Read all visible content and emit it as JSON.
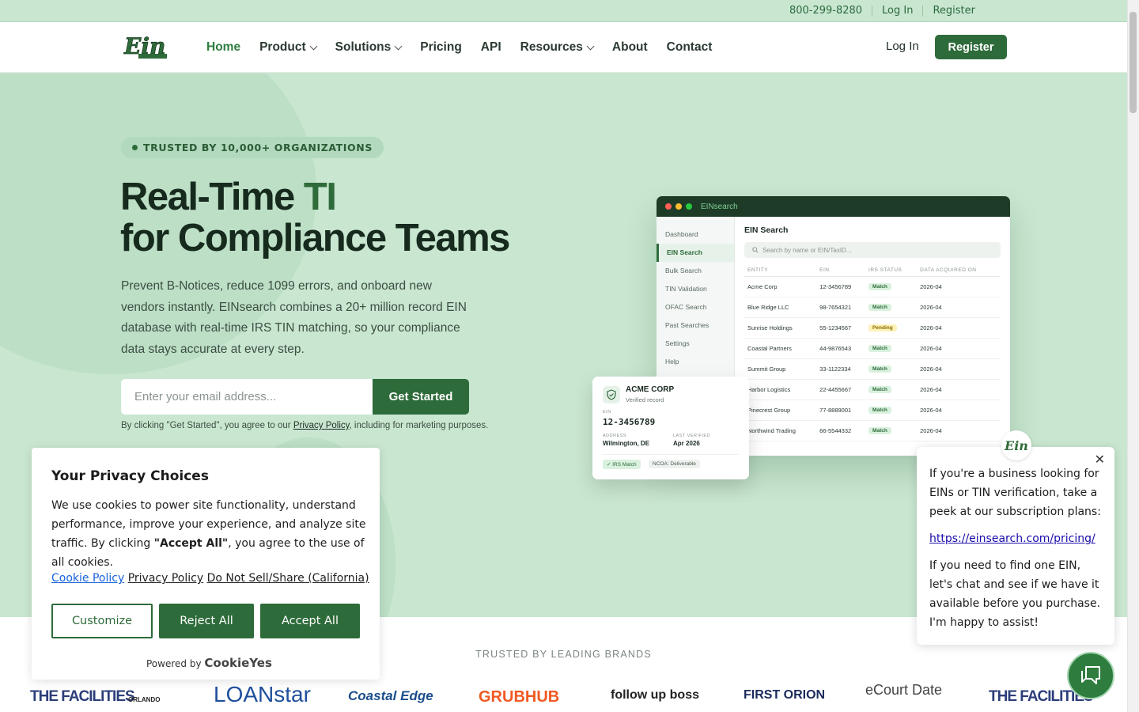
{
  "topbar": {
    "phone": "800-299-8280",
    "login": "Log In",
    "register": "Register"
  },
  "nav": {
    "items": [
      {
        "label": "Home"
      },
      {
        "label": "Product"
      },
      {
        "label": "Solutions"
      },
      {
        "label": "Pricing"
      },
      {
        "label": "API"
      },
      {
        "label": "Resources"
      },
      {
        "label": "About"
      },
      {
        "label": "Contact"
      }
    ],
    "login": "Log In",
    "register": "Register",
    "logo": "EIN"
  },
  "hero": {
    "badge": "TRUSTED BY 10,000+ ORGANIZATIONS",
    "title_line1_a": "Real-Time ",
    "title_line1_b": "TI",
    "title_line2": "for Compliance Teams",
    "subtitle": "Prevent B-Notices, reduce 1099 errors, and onboard new vendors instantly. EINsearch combines a 20+ million record EIN database with real-time IRS TIN matching, so your compliance data stays accurate at every step.",
    "email_placeholder": "Enter your email address...",
    "cta": "Get Started",
    "terms_pre": "By clicking \"Get Started\", you agree to our ",
    "terms_link": "Privacy Policy",
    "terms_post": ", including for marketing purposes."
  },
  "app_preview": {
    "window_title": "EINsearch",
    "sidebar": [
      "Dashboard",
      "EIN Search",
      "Bulk Search",
      "TIN Validation",
      "OFAC Search",
      "Past Searches",
      "Settings",
      "Help"
    ],
    "heading": "EIN Search",
    "search_placeholder": "Search by name or EIN/TaxID...",
    "columns": [
      "ENTITY",
      "EIN",
      "IRS STATUS",
      "DATA ACQUIRED ON"
    ],
    "rows": [
      {
        "entity": "Acme Corp",
        "ein": "12-3456789",
        "status": "Match",
        "date": "2026-04"
      },
      {
        "entity": "Blue Ridge LLC",
        "ein": "98-7654321",
        "status": "Match",
        "date": "2026-04"
      },
      {
        "entity": "Sunrise Holdings",
        "ein": "55-1234567",
        "status": "Pending",
        "date": "2026-04"
      },
      {
        "entity": "Coastal Partners",
        "ein": "44-9876543",
        "status": "Match",
        "date": "2026-04"
      },
      {
        "entity": "Summit Group",
        "ein": "33-1122334",
        "status": "Match",
        "date": "2026-04"
      },
      {
        "entity": "Harbor Logistics",
        "ein": "22-4455667",
        "status": "Match",
        "date": "2026-04"
      },
      {
        "entity": "Pinecrest Group",
        "ein": "77-8889001",
        "status": "Match",
        "date": "2026-04"
      },
      {
        "entity": "Northwind Trading",
        "ein": "66-5544332",
        "status": "Match",
        "date": "2026-04"
      }
    ]
  },
  "record_card": {
    "name": "ACME CORP",
    "verified": "Verified record",
    "ein_label": "EIN",
    "ein": "12-3456789",
    "address_label": "ADDRESS",
    "address": "Wilmington, DE",
    "last_label": "LAST VERIFIED",
    "last": "Apr 2026",
    "tag1": "✓ IRS Match",
    "tag2": "NCOA: Deliverable"
  },
  "cookie": {
    "title": "Your Privacy Choices",
    "body_pre": "We use cookies to power site functionality, understand performance, improve your experience, and analyze site traffic. By clicking ",
    "body_bold": "\"Accept All\"",
    "body_post": ", you agree to the use of all cookies.",
    "link1": "Cookie Policy",
    "link2": "Privacy Policy",
    "link3": "Do Not Sell/Share (California)",
    "customize": "Customize",
    "reject": "Reject All",
    "accept": "Accept All",
    "powered": "Powered by",
    "brand": "CookieYes"
  },
  "chat": {
    "close": "✕",
    "p1": "If you're a business looking for EINs or TIN verification, take a peek at our subscription plans:",
    "link": "https://einsearch.com/pricing/",
    "p2": "If you need to find one EIN, let's chat and see if we have it available before you purchase. I'm happy to assist!"
  },
  "trusted": {
    "title": "TRUSTED BY LEADING BRANDS",
    "brands": [
      "THE FACILITIES",
      "ORLANDO",
      "LOANstar",
      "Coastal Edge",
      "GRUBHUB",
      "follow up boss",
      "FIRST ORION",
      "eCourt Date",
      "THE FACILITIES"
    ]
  },
  "colors": {
    "brand_green": "#2e6b3a",
    "hero_bg": "#c8e6d0",
    "pending": "#fdf1b8"
  }
}
